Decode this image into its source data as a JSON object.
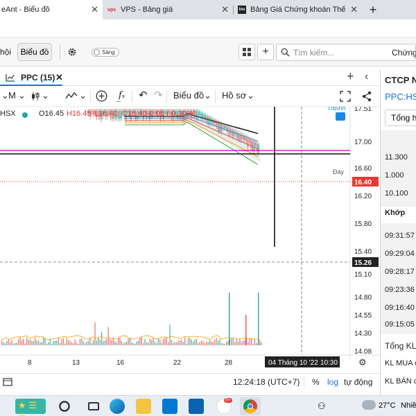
{
  "browser": {
    "tabs": [
      {
        "title": "eAnt - Biểu đồ",
        "active": true
      },
      {
        "title": "VPS - Bảng giá",
        "active": false
      },
      {
        "title": "Bảng Giá Chứng khoán Thế Giới",
        "active": false
      }
    ],
    "new_tab_label": "+"
  },
  "toolbar": {
    "left_cut_label": "hội",
    "bieudo_label": "Biểu đồ",
    "theme_toggle_label": "Sáng",
    "search_placeholder": "Tìm kiếm...",
    "right_cut_label": "Chứng"
  },
  "chart": {
    "tab_label": "PPC (15)",
    "interval_label": "M",
    "bieudo_menu": "Biểu đồ",
    "hoso_menu": "Hồ sơ",
    "exchange_label": "HSX",
    "ohlc": {
      "o": "O16.45",
      "h": "H16.45",
      "l": "L16.40",
      "c": "C16.40",
      "chg": "-0.05 (-0.30%)"
    },
    "price_axis": [
      "17.51",
      "17.00",
      "16.60",
      "16.20",
      "15.80",
      "15.40",
      "15.10",
      "14.80",
      "14.55",
      "14.30",
      "14.08"
    ],
    "tag_trbinh_label": "TrBình",
    "tag_trbinh_value": "17.51",
    "tag_day_label": "Đáy",
    "tag_day_value": "16.40",
    "last_price": "16.40",
    "crosshair_price": "15.26",
    "time_axis": [
      "8",
      "13",
      "16",
      "22",
      "28"
    ],
    "crosshair_time": "04 Tháng 10 '22",
    "crosshair_clock": "10:30",
    "colors": {
      "up": "#26a69a",
      "down": "#ef5350",
      "magenta": "#c000c0",
      "red_dotted": "#e53935"
    }
  },
  "bottom": {
    "clock": "12:24:18 (UTC+7)",
    "percent": "%",
    "log": "log",
    "auto": "tự động"
  },
  "right_panel": {
    "title": "CTCP N",
    "symbol": "PPC:HS",
    "tab": "Tổng h",
    "values": [
      "11.300",
      "1.000",
      "10.100"
    ],
    "khop_label": "Khớp",
    "times": [
      "09:31:57",
      "09:29:04",
      "09:28:17",
      "09:23:36",
      "09:16:40",
      "09:15:05"
    ],
    "tong_kl": "Tổng KL",
    "kl_mua": "KL MUA c",
    "kl_ban": "KL BÁN c"
  },
  "taskbar": {
    "temp": "27°C",
    "weather_cut": "Nhiề",
    "badge": "5+"
  }
}
